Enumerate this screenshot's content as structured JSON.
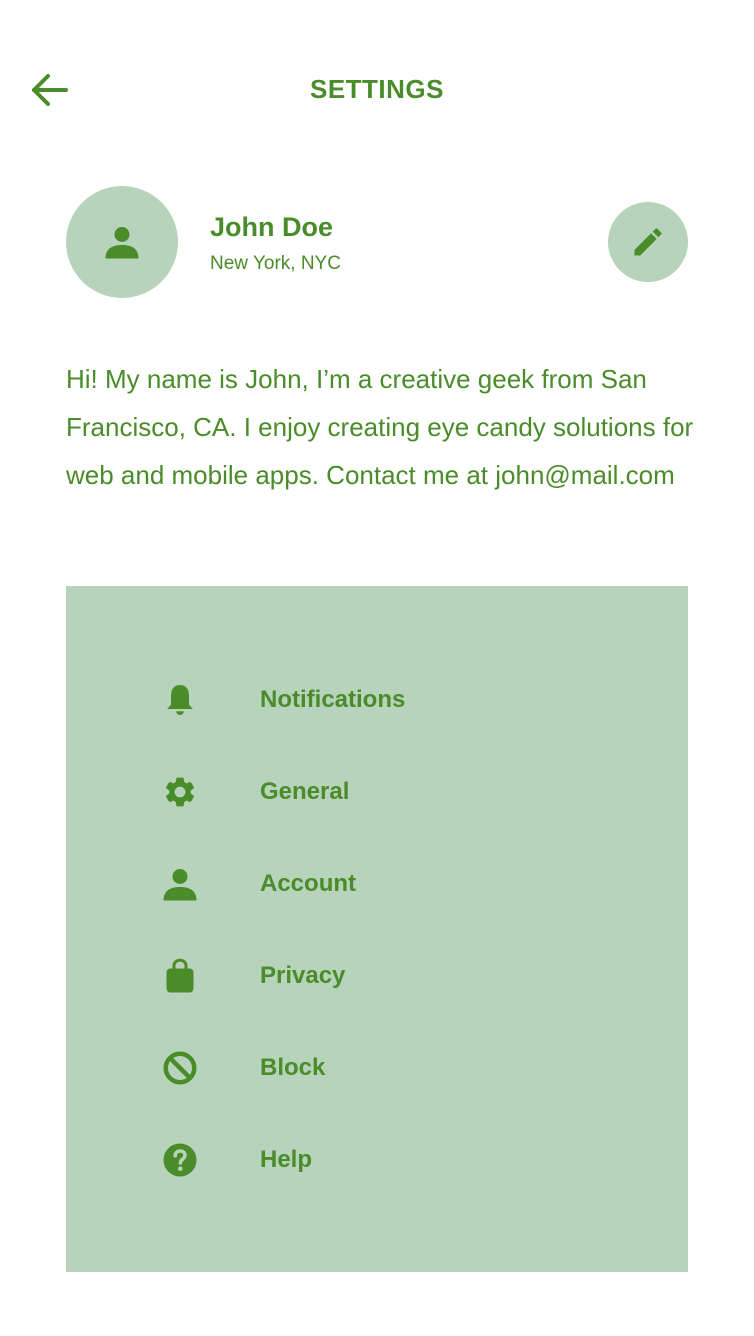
{
  "header": {
    "back_icon": "arrow-left-icon",
    "title": "SETTINGS"
  },
  "profile": {
    "avatar_icon": "person-icon",
    "name": "John Doe",
    "location": "New York, NYC",
    "edit_icon": "pencil-icon"
  },
  "bio": "Hi! My name is John, I’m a creative geek from San Francisco, CA. I enjoy creating eye candy solutions for web and mobile apps. Contact me at john@mail.com",
  "menu": {
    "items": [
      {
        "label": "Notifications",
        "icon": "bell-icon"
      },
      {
        "label": "General",
        "icon": "gear-icon"
      },
      {
        "label": "Account",
        "icon": "person-icon"
      },
      {
        "label": "Privacy",
        "icon": "bag-icon"
      },
      {
        "label": "Block",
        "icon": "block-icon"
      },
      {
        "label": "Help",
        "icon": "help-icon"
      }
    ]
  },
  "colors": {
    "accent": "#4a8c2a",
    "panel": "#b7d3bb",
    "background": "#ffffff"
  }
}
